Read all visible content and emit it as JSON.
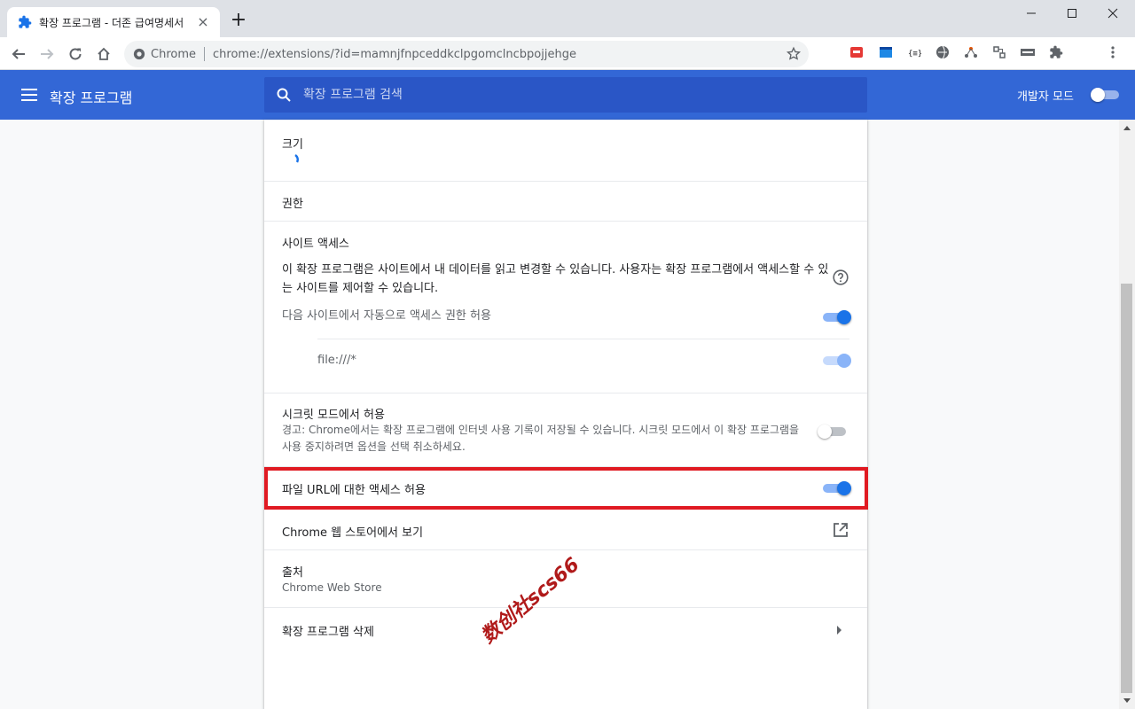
{
  "browser": {
    "tab_title": "확장 프로그램 - 더존 급여명세서",
    "tab_close": "×",
    "new_tab": "+",
    "site_label": "Chrome",
    "url": "chrome://extensions/?id=mamnjfnpceddkclpgomclncbpojjehge"
  },
  "header": {
    "title": "확장 프로그램",
    "search_placeholder": "확장 프로그램 검색",
    "dev_mode_label": "개발자 모드"
  },
  "details": {
    "size_label": "크기",
    "permissions_label": "권한",
    "site_access": {
      "label": "사이트 액세스",
      "description": "이 확장 프로그램은 사이트에서 내 데이터를 읽고 변경할 수 있습니다. 사용자는 확장 프로그램에서 액세스할 수 있는 사이트를 제어할 수 있습니다.",
      "auto_allow_label": "다음 사이트에서 자동으로 액세스 권한 허용",
      "site_pattern": "file:///*"
    },
    "incognito": {
      "label": "시크릿 모드에서 허용",
      "warning": "경고: Chrome에서는 확장 프로그램에 인터넷 사용 기록이 저장될 수 있습니다. 시크릿 모드에서 이 확장 프로그램을 사용 중지하려면 옵션을 선택 취소하세요."
    },
    "file_url_label": "파일 URL에 대한 액세스 허용",
    "webstore_label": "Chrome 웹 스토어에서 보기",
    "source": {
      "label": "출처",
      "value": "Chrome Web Store"
    },
    "remove_label": "확장 프로그램 삭제"
  },
  "watermark": "数创社scs66",
  "colors": {
    "accent": "#3367d6",
    "toggle_on": "#1a73e8",
    "highlight": "#e01a22"
  }
}
